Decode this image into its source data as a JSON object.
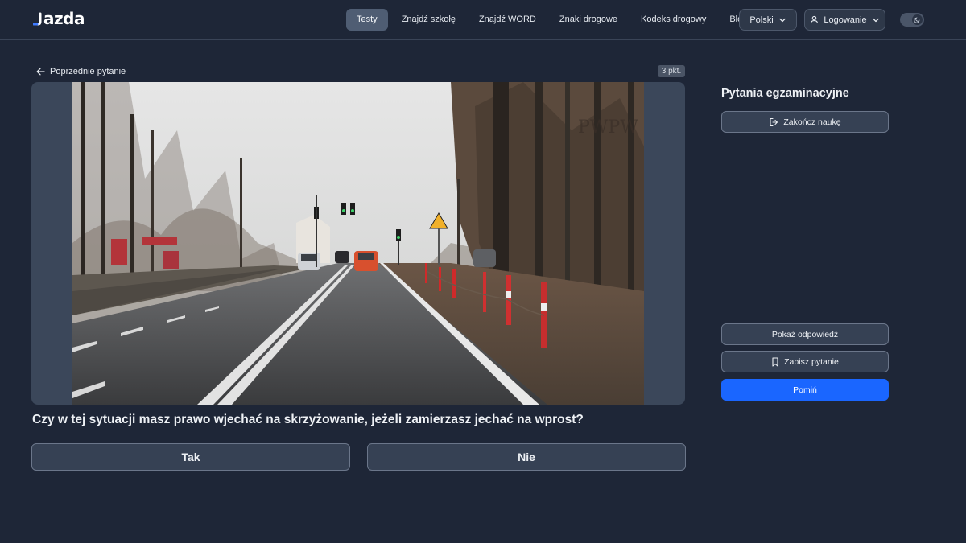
{
  "header": {
    "logo_text": "azda",
    "nav": [
      {
        "label": "Testy",
        "active": true
      },
      {
        "label": "Znajdź szkołę",
        "active": false
      },
      {
        "label": "Znajdź WORD",
        "active": false
      },
      {
        "label": "Znaki drogowe",
        "active": false
      },
      {
        "label": "Kodeks drogowy",
        "active": false
      },
      {
        "label": "Blog",
        "active": false
      }
    ],
    "language": "Polski",
    "login_label": "Logowanie",
    "theme_toggle": {
      "mode": "dark",
      "icon": "moon-icon"
    }
  },
  "main": {
    "back_label": "Poprzednie pytanie",
    "points_badge": "3 pkt.",
    "watermark": "PWPW",
    "question": "Czy w tej sytuacji masz prawo wjechać na skrzyżowanie, jeżeli zamierzasz jechać na wprost?",
    "answers": [
      "Tak",
      "Nie"
    ]
  },
  "sidebar": {
    "title": "Pytania egzaminacyjne",
    "end_button": "Zakończ naukę",
    "show_answer_button": "Pokaż odpowiedź",
    "save_button": "Zapisz pytanie",
    "skip_button": "Pomiń"
  },
  "colors": {
    "background": "#1e2637",
    "accent": "#1a66ff",
    "active_nav": "#4f5d73",
    "button_bg": "#364154"
  }
}
